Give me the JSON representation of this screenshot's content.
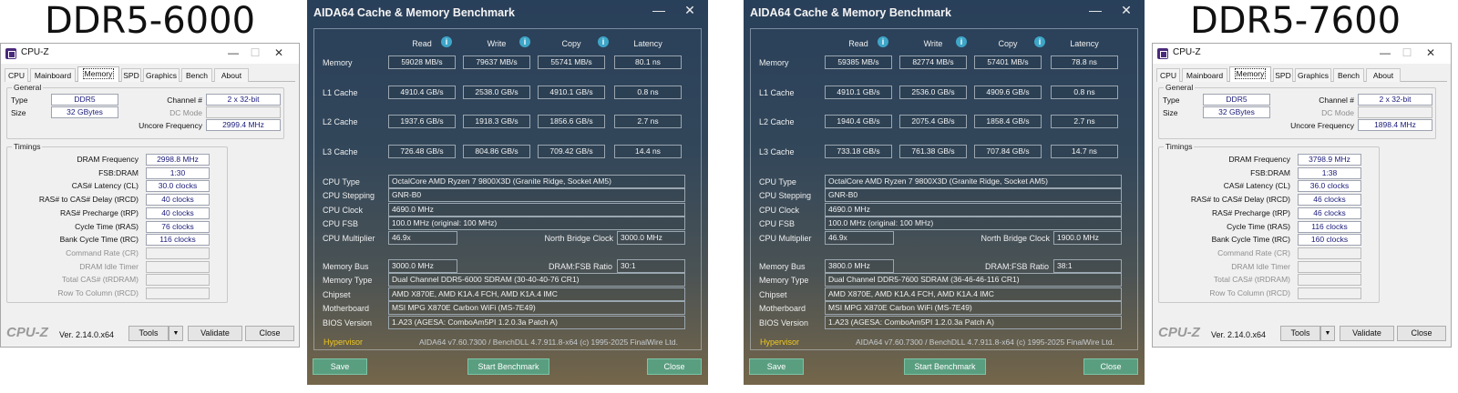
{
  "labels": {
    "left": "DDR5-6000",
    "right": "DDR5-7600"
  },
  "cpuz": {
    "title": "CPU-Z",
    "tabs": [
      "CPU",
      "Mainboard",
      "Memory",
      "SPD",
      "Graphics",
      "Bench",
      "About"
    ],
    "active_tab": "Memory",
    "general_label": "General",
    "timings_label": "Timings",
    "type_label": "Type",
    "size_label": "Size",
    "channel_label": "Channel #",
    "dcmode_label": "DC Mode",
    "uncore_label": "Uncore Frequency",
    "timing_labels": [
      "DRAM Frequency",
      "FSB:DRAM",
      "CAS# Latency (CL)",
      "RAS# to CAS# Delay (tRCD)",
      "RAS# Precharge (tRP)",
      "Cycle Time (tRAS)",
      "Bank Cycle Time (tRC)",
      "Command Rate (CR)",
      "DRAM Idle Timer",
      "Total CAS# (tRDRAM)",
      "Row To Column (tRCD)"
    ],
    "brand": "CPU-Z",
    "version": "Ver. 2.14.0.x64",
    "tools_btn": "Tools",
    "validate_btn": "Validate",
    "close_btn": "Close",
    "left": {
      "type": "DDR5",
      "size": "32 GBytes",
      "channel": "2 x 32-bit",
      "dcmode": "",
      "uncore": "2999.4 MHz",
      "timings": [
        "2998.8 MHz",
        "1:30",
        "30.0 clocks",
        "40 clocks",
        "40 clocks",
        "76 clocks",
        "116 clocks",
        "",
        "",
        "",
        ""
      ]
    },
    "right": {
      "type": "DDR5",
      "size": "32 GBytes",
      "channel": "2 x 32-bit",
      "dcmode": "",
      "uncore": "1898.4 MHz",
      "timings": [
        "3798.9 MHz",
        "1:38",
        "36.0 clocks",
        "46 clocks",
        "46 clocks",
        "116 clocks",
        "160 clocks",
        "",
        "",
        "",
        ""
      ]
    }
  },
  "aida": {
    "title": "AIDA64 Cache & Memory Benchmark",
    "columns": [
      "Read",
      "Write",
      "Copy",
      "Latency"
    ],
    "row_labels": [
      "Memory",
      "L1 Cache",
      "L2 Cache",
      "L3 Cache"
    ],
    "info_labels": [
      "CPU Type",
      "CPU Stepping",
      "CPU Clock",
      "CPU FSB",
      "CPU Multiplier"
    ],
    "nb_label": "North Bridge Clock",
    "mem_labels": [
      "Memory Bus",
      "Memory Type",
      "Chipset",
      "Motherboard",
      "BIOS Version"
    ],
    "ratio_label": "DRAM:FSB Ratio",
    "hypervisor": "Hypervisor",
    "footer": "AIDA64 v7.60.7300 / BenchDLL 4.7.911.8-x64  (c) 1995-2025 FinalWire Ltd.",
    "buttons": {
      "save": "Save",
      "start": "Start Benchmark",
      "close": "Close"
    },
    "left": {
      "bench": [
        [
          "59028 MB/s",
          "79637 MB/s",
          "55741 MB/s",
          "80.1 ns"
        ],
        [
          "4910.4 GB/s",
          "2538.0 GB/s",
          "4910.1 GB/s",
          "0.8 ns"
        ],
        [
          "1937.6 GB/s",
          "1918.3 GB/s",
          "1856.6 GB/s",
          "2.7 ns"
        ],
        [
          "726.48 GB/s",
          "804.86 GB/s",
          "709.42 GB/s",
          "14.4 ns"
        ]
      ],
      "cpu_type": "OctalCore AMD Ryzen 7 9800X3D  (Granite Ridge, Socket AM5)",
      "cpu_stepping": "GNR-B0",
      "cpu_clock": "4690.0 MHz",
      "cpu_fsb": "100.0 MHz  (original: 100 MHz)",
      "cpu_mult": "46.9x",
      "nb_clock": "3000.0 MHz",
      "mem_bus": "3000.0 MHz",
      "ratio": "30:1",
      "mem_type": "Dual Channel DDR5-6000 SDRAM  (30-40-40-76 CR1)",
      "chipset": "AMD X870E, AMD K1A.4 FCH, AMD K1A.4 IMC",
      "motherboard": "MSI MPG X870E Carbon WiFi (MS-7E49)",
      "bios": "1.A23  (AGESA: ComboAm5PI 1.2.0.3a Patch A)"
    },
    "right": {
      "bench": [
        [
          "59385 MB/s",
          "82774 MB/s",
          "57401 MB/s",
          "78.8 ns"
        ],
        [
          "4910.1 GB/s",
          "2536.0 GB/s",
          "4909.6 GB/s",
          "0.8 ns"
        ],
        [
          "1940.4 GB/s",
          "2075.4 GB/s",
          "1858.4 GB/s",
          "2.7 ns"
        ],
        [
          "733.18 GB/s",
          "761.38 GB/s",
          "707.84 GB/s",
          "14.7 ns"
        ]
      ],
      "cpu_type": "OctalCore AMD Ryzen 7 9800X3D  (Granite Ridge, Socket AM5)",
      "cpu_stepping": "GNR-B0",
      "cpu_clock": "4690.0 MHz",
      "cpu_fsb": "100.0 MHz  (original: 100 MHz)",
      "cpu_mult": "46.9x",
      "nb_clock": "1900.0 MHz",
      "mem_bus": "3800.0 MHz",
      "ratio": "38:1",
      "mem_type": "Dual Channel DDR5-7600 SDRAM  (36-46-46-116 CR1)",
      "chipset": "AMD X870E, AMD K1A.4 FCH, AMD K1A.4 IMC",
      "motherboard": "MSI MPG X870E Carbon WiFi (MS-7E49)",
      "bios": "1.A23  (AGESA: ComboAm5PI 1.2.0.3a Patch A)"
    }
  }
}
